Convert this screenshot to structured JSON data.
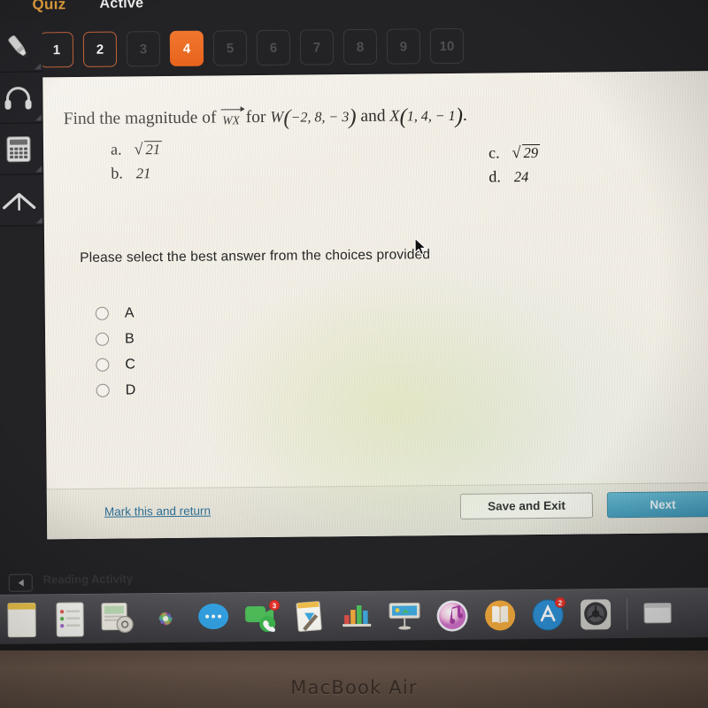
{
  "header": {
    "quiz_label": "Quiz",
    "status_label": "Active"
  },
  "question_nav": {
    "items": [
      {
        "number": "1",
        "state": "answered"
      },
      {
        "number": "2",
        "state": "answered"
      },
      {
        "number": "3",
        "state": "unanswered"
      },
      {
        "number": "4",
        "state": "current"
      },
      {
        "number": "5",
        "state": "unanswered"
      },
      {
        "number": "6",
        "state": "unanswered"
      },
      {
        "number": "7",
        "state": "unanswered"
      },
      {
        "number": "8",
        "state": "unanswered"
      },
      {
        "number": "9",
        "state": "unanswered"
      },
      {
        "number": "10",
        "state": "unanswered"
      }
    ]
  },
  "tools": [
    {
      "name": "highlighter-tool",
      "icon": "highlighter-icon"
    },
    {
      "name": "audio-tool",
      "icon": "headphones-icon"
    },
    {
      "name": "calculator-tool",
      "icon": "calculator-icon"
    },
    {
      "name": "protractor-tool",
      "icon": "protractor-icon"
    }
  ],
  "question": {
    "lead": "Find the magnitude of",
    "vector": "WX",
    "mid": "for",
    "point_w_label": "W",
    "point_w_coords": "−2, 8, − 3",
    "conjunction": "and",
    "point_x_label": "X",
    "point_x_coords": "1, 4, − 1",
    "period": "."
  },
  "choices": [
    {
      "letter": "a.",
      "value": "21",
      "radical": true
    },
    {
      "letter": "b.",
      "value": "21",
      "radical": false
    },
    {
      "letter": "c.",
      "value": "29",
      "radical": true
    },
    {
      "letter": "d.",
      "value": "24",
      "radical": false
    }
  ],
  "prompt": "Please select the best answer from the choices provided",
  "answer_options": [
    {
      "label": "A",
      "selected": false
    },
    {
      "label": "B",
      "selected": false
    },
    {
      "label": "C",
      "selected": false
    },
    {
      "label": "D",
      "selected": false
    }
  ],
  "footer": {
    "mark_link": "Mark this and return",
    "save_exit": "Save and Exit",
    "next": "Next"
  },
  "bottom_strip": {
    "faint_text": "Reading Activity"
  },
  "dock": {
    "items": [
      {
        "name": "notes-icon",
        "badge": ""
      },
      {
        "name": "contacts-icon",
        "badge": ""
      },
      {
        "name": "reminders-icon",
        "badge": ""
      },
      {
        "name": "photos-icon",
        "badge": ""
      },
      {
        "name": "messages-icon",
        "badge": ""
      },
      {
        "name": "facetime-icon",
        "badge": "3"
      },
      {
        "name": "pages-icon",
        "badge": ""
      },
      {
        "name": "numbers-icon",
        "badge": ""
      },
      {
        "name": "keynote-icon",
        "badge": ""
      },
      {
        "name": "itunes-icon",
        "badge": ""
      },
      {
        "name": "ibooks-icon",
        "badge": ""
      },
      {
        "name": "app-store-icon",
        "badge": "2"
      },
      {
        "name": "system-preferences-icon",
        "badge": ""
      }
    ]
  },
  "device": {
    "model_label": "MacBook Air"
  },
  "colors": {
    "accent_orange": "#e8631d",
    "title_gold": "#e8a33d",
    "next_blue": "#3f97b8",
    "link_blue": "#2d6f94"
  }
}
